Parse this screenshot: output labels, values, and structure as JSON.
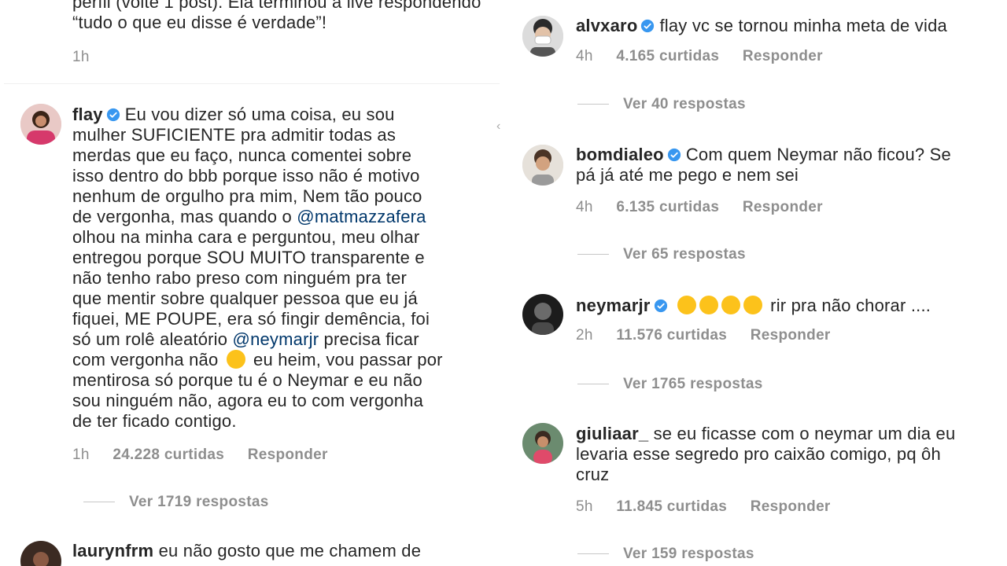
{
  "left": {
    "top_fragment": {
      "line1": "perfil (volte 1 post). Ela terminou a live respondendo",
      "line2": "“tudo o que eu disse é verdade”!",
      "time": "1h"
    },
    "flay": {
      "username": "flay",
      "lines": [
        "Eu vou dizer só uma coisa, eu sou",
        "mulher SUFICIENTE pra admitir todas as",
        "merdas que eu faço, nunca comentei sobre",
        "isso dentro do bbb porque isso não é motivo",
        "nenhum de orgulho pra mim, Nem tão pouco",
        "de vergonha, mas quando o ",
        "olhou na minha cara e perguntou, meu olhar",
        "entregou porque SOU MUITO transparente e",
        "não tenho rabo  preso com ninguém pra ter",
        "que mentir sobre qualquer pessoa que eu já",
        "fiquei, ME POUPE, era só fingir demência, foi",
        "só um rolê aleatório ",
        " precisa ficar",
        "com vergonha não ",
        " eu heim, vou passar por",
        "mentirosa só porque tu é o Neymar e eu não",
        "sou ninguém não, agora eu to com vergonha",
        "de ter ficado contigo."
      ],
      "mention1": "@matmazzafera",
      "mention2": "@neymarjr",
      "time": "1h",
      "likes": "24.228 curtidas",
      "reply": "Responder",
      "view_replies": "Ver 1719 respostas"
    },
    "laurynfrm": {
      "username": "laurynfrm",
      "text": "eu não gosto que me chamem de"
    }
  },
  "right": {
    "alvxaro": {
      "username": "alvxaro",
      "text": "flay vc se tornou minha meta de vida",
      "time": "4h",
      "likes": "4.165 curtidas",
      "reply": "Responder",
      "view_replies": "Ver 40 respostas"
    },
    "bomdialeo": {
      "username": "bomdialeo",
      "line1": "Com quem Neymar não ficou? Se",
      "line2": "pá já até me pego e nem sei",
      "time": "4h",
      "likes": "6.135 curtidas",
      "reply": "Responder",
      "view_replies": "Ver 65 respostas"
    },
    "neymarjr": {
      "username": "neymarjr",
      "text": "rir pra não chorar ....",
      "time": "2h",
      "likes": "11.576 curtidas",
      "reply": "Responder",
      "view_replies": "Ver 1765 respostas"
    },
    "giuliaar": {
      "username": "giuliaar_",
      "line1": "se eu ficasse com o neymar um dia eu",
      "line2": "levaria esse segredo pro caixão comigo, pq ôh",
      "line3": "cruz",
      "time": "5h",
      "likes": "11.845 curtidas",
      "reply": "Responder",
      "view_replies": "Ver 159 respostas"
    }
  },
  "colors": {
    "text": "#262626",
    "meta": "#8e8e8e",
    "mention": "#00376b",
    "verified": "#3897f0"
  }
}
